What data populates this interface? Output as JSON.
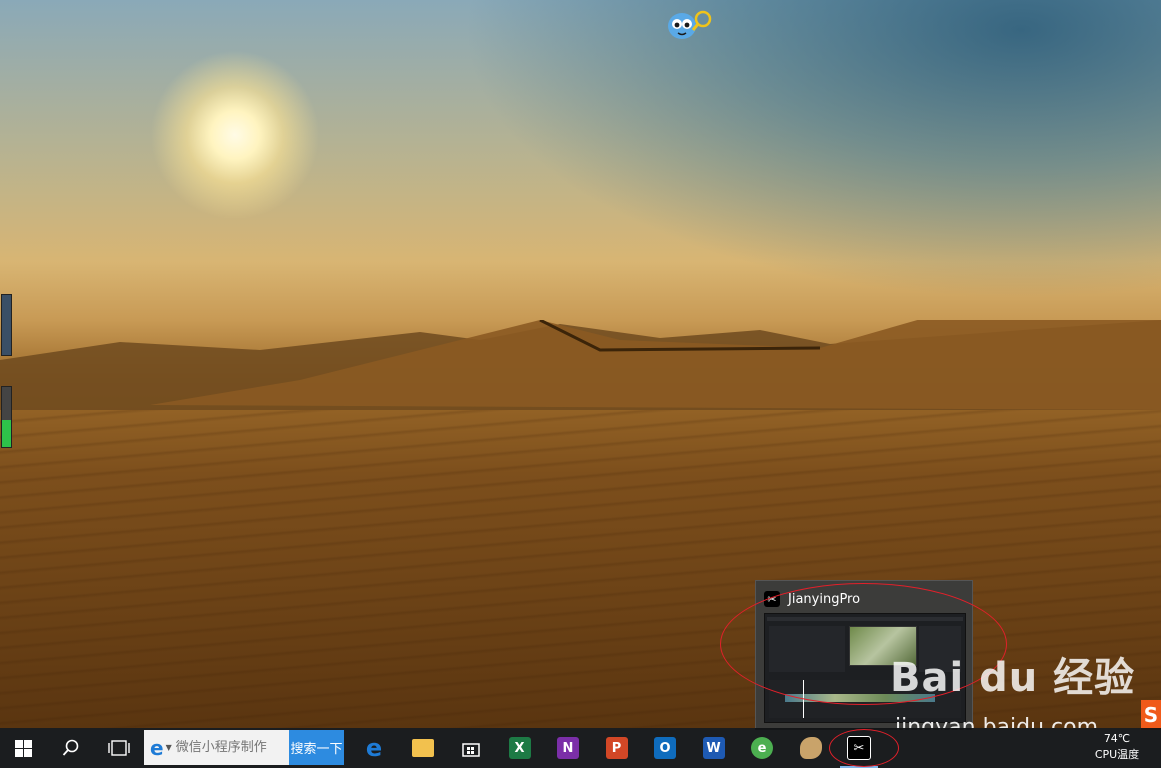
{
  "window_preview": {
    "title": "JianyingPro",
    "app_icon_glyph": "✂",
    "border_color": "#3c3c3a"
  },
  "taskbar": {
    "search_placeholder": "微信小程序制作",
    "search_button_label": "搜索一下",
    "apps": [
      {
        "name": "edge",
        "glyph": "e",
        "color": "#1e7bd6"
      },
      {
        "name": "file-explorer",
        "glyph": "",
        "color": "#f2c14e"
      },
      {
        "name": "store",
        "glyph": "",
        "color": "#ffffff"
      },
      {
        "name": "excel",
        "glyph": "X",
        "color": "#1d7a45"
      },
      {
        "name": "onenote",
        "glyph": "N",
        "color": "#7b2fa8"
      },
      {
        "name": "powerpoint",
        "glyph": "P",
        "color": "#d24726"
      },
      {
        "name": "outlook",
        "glyph": "O",
        "color": "#0f6cbd"
      },
      {
        "name": "word",
        "glyph": "W",
        "color": "#1e5ab3"
      },
      {
        "name": "browser-green",
        "glyph": "e",
        "color": "#4caf50"
      },
      {
        "name": "paint",
        "glyph": "",
        "color": "#c9a36a"
      },
      {
        "name": "jianying",
        "glyph": "✂",
        "color": "#000000"
      }
    ],
    "active_app": "jianying",
    "tray": {
      "temperature": "74℃",
      "temperature_label": "CPU温度"
    }
  },
  "desktop": {
    "gauge_level": 0.45,
    "gauge_color": "#2ec24a"
  },
  "watermark": {
    "brand": "Bai du 经验",
    "url": "jingyan.baidu.com",
    "badge": "S"
  },
  "annotations": {
    "highlight_color": "#e2202a"
  }
}
